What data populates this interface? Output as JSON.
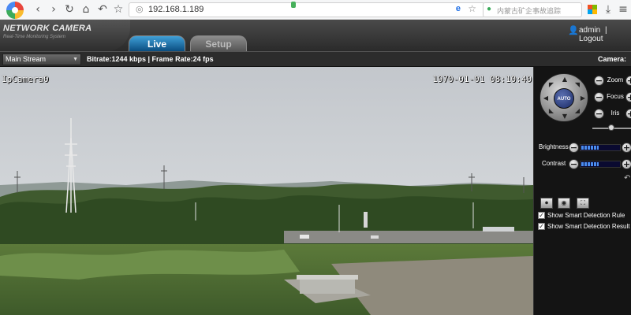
{
  "browser": {
    "url": "192.168.1.189",
    "url_badge": "",
    "search_placeholder": "内蒙古矿企事故追踪",
    "nav_icons": [
      "back-icon",
      "forward-icon",
      "reload-icon",
      "home-icon",
      "undo-icon",
      "star-icon"
    ]
  },
  "header": {
    "brand_title": "NETWORK CAMERA",
    "brand_subtitle": "Real-Time Monitoring System",
    "tabs": [
      {
        "label": "Live",
        "active": true
      },
      {
        "label": "Setup",
        "active": false
      }
    ],
    "user": "admin",
    "separator": "|",
    "logout": "Logout"
  },
  "stream_bar": {
    "stream_select": "Main Stream",
    "bitrate_info": "Bitrate:1244 kbps | Frame Rate:24 fps",
    "camera_label": "Camera:"
  },
  "video": {
    "osd_name": "IpCamera0",
    "osd_time": "1970-01-01  08:10:40"
  },
  "ptz": {
    "auto_label": "AUTO",
    "zoom_label": "Zoom",
    "focus_label": "Focus",
    "iris_label": "Iris",
    "minus": "−",
    "plus": "+",
    "brightness_label": "Brightness",
    "contrast_label": "Contrast",
    "brightness_level": 0.45,
    "contrast_level": 0.45
  },
  "options": {
    "show_rule_label": "Show Smart Detection Rule",
    "show_result_label": "Show Smart Detection Result",
    "show_rule_checked": true,
    "show_result_checked": true
  },
  "colors": {
    "live_tab": "#1a6fb0",
    "level_bar": "#4a8cf0",
    "panel_bg": "#141414"
  }
}
